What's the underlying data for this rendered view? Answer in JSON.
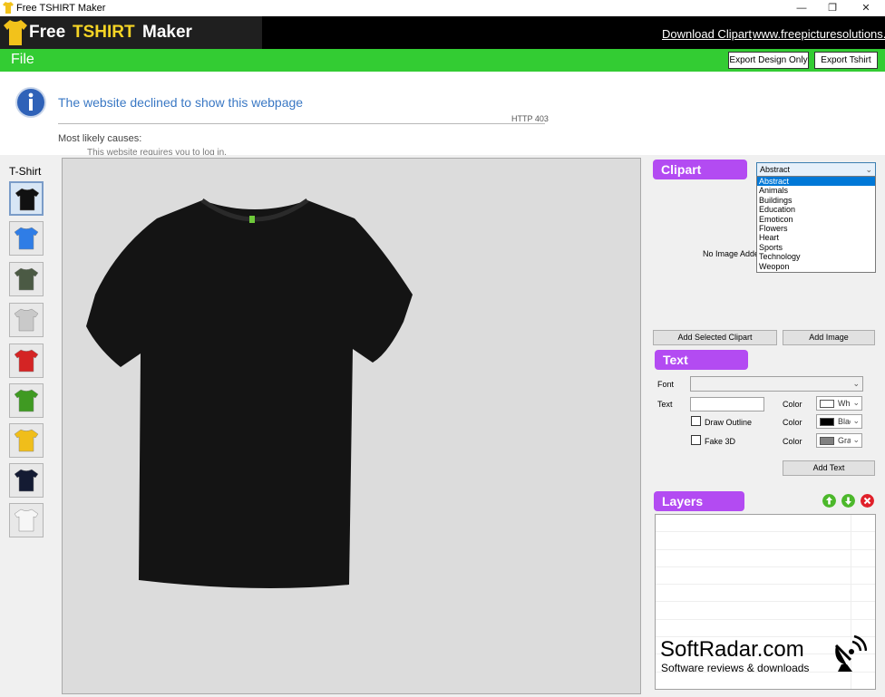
{
  "window": {
    "title": "Free TSHIRT Maker",
    "controls": {
      "minimize": "—",
      "maximize": "❐",
      "close": "✕"
    }
  },
  "header": {
    "brand": {
      "free": "Free",
      "tshirt": "TSHIRT",
      "maker": "Maker"
    },
    "link_clipart": "Download Clipart",
    "link_site": "www.freepicturesolutions.com"
  },
  "menu": {
    "file": "File",
    "export_design": "Export Design Only",
    "export_tshirt": "Export Tshirt"
  },
  "error_page": {
    "title": "The website declined to show this webpage",
    "code": "HTTP 403",
    "causes": "Most likely causes:",
    "cut_line": "This website requires you to log in."
  },
  "tshirt_panel": {
    "label": "T-Shirt",
    "swatches": [
      {
        "name": "black",
        "color": "#111111"
      },
      {
        "name": "blue",
        "color": "#2f7de6"
      },
      {
        "name": "army-green",
        "color": "#4b5a44"
      },
      {
        "name": "heather-grey",
        "color": "#c9c9c9"
      },
      {
        "name": "red",
        "color": "#d42424"
      },
      {
        "name": "green",
        "color": "#3f9a22"
      },
      {
        "name": "yellow",
        "color": "#f0be1a"
      },
      {
        "name": "navy",
        "color": "#141b33"
      },
      {
        "name": "white",
        "color": "#f6f6f6"
      }
    ]
  },
  "canvas": {
    "shirt_color": "#141414"
  },
  "clipart": {
    "heading": "Clipart",
    "selected": "Abstract",
    "options": [
      "Abstract",
      "Animals",
      "Buildings",
      "Education",
      "Emoticon",
      "Flowers",
      "Heart",
      "Sports",
      "Technology",
      "Weopon"
    ],
    "no_image": "No Image Added",
    "add_selected": "Add Selected Clipart",
    "add_image": "Add Image"
  },
  "text": {
    "heading": "Text",
    "font_label": "Font",
    "font_value": "",
    "text_label": "Text",
    "text_value": "",
    "color_label": "Color",
    "draw_outline": "Draw Outline",
    "fake_3d": "Fake 3D",
    "colors": [
      {
        "name": "White",
        "hex": "#ffffff"
      },
      {
        "name": "Black",
        "hex": "#000000"
      },
      {
        "name": "Gray",
        "hex": "#808080"
      }
    ],
    "add_text": "Add Text"
  },
  "layers": {
    "heading": "Layers"
  },
  "watermark": {
    "title": "SoftRadar.com",
    "subtitle": "Software reviews & downloads"
  }
}
